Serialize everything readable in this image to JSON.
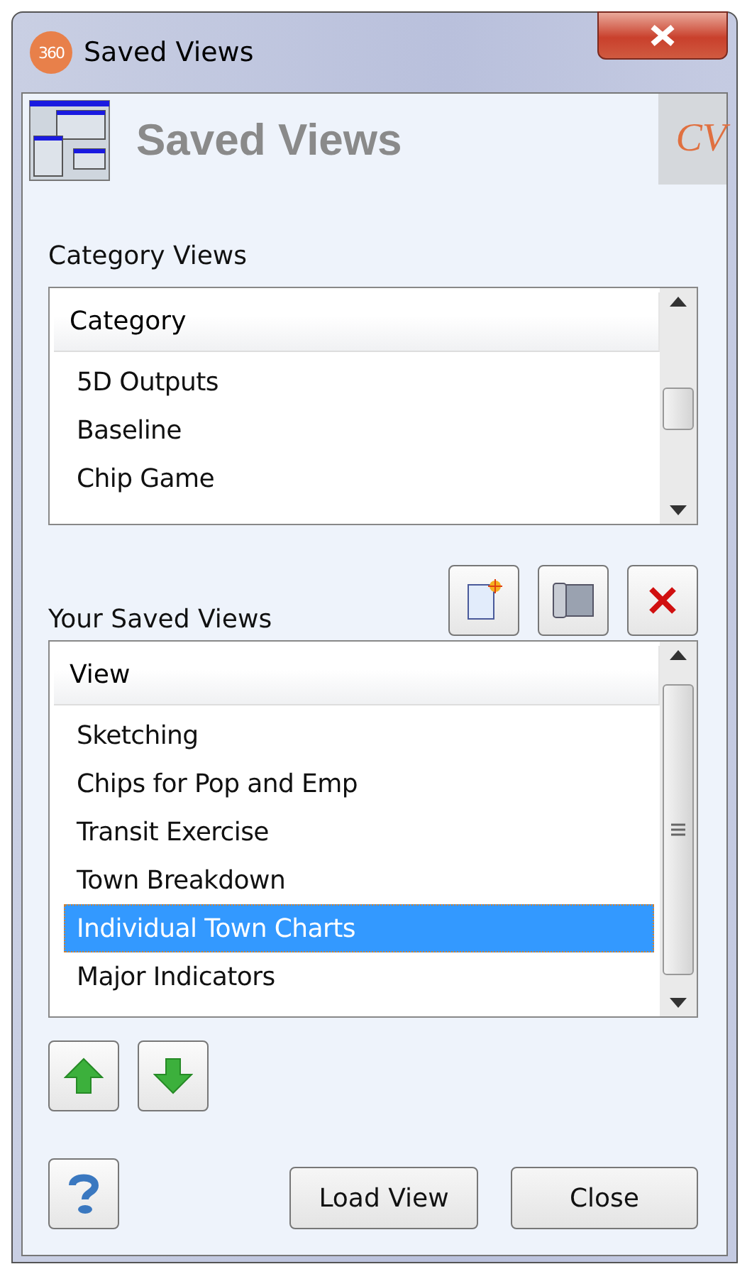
{
  "window": {
    "app_badge": "360",
    "title": "Saved Views"
  },
  "header": {
    "title": "Saved Views",
    "logo": "CV"
  },
  "category_views": {
    "label": "Category Views",
    "column": "Category",
    "items": [
      {
        "label": "5D Outputs",
        "selected": false
      },
      {
        "label": "Baseline",
        "selected": false
      },
      {
        "label": "Chip Game",
        "selected": false
      }
    ]
  },
  "saved_views": {
    "label": "Your Saved Views",
    "column": "View",
    "items": [
      {
        "label": "Sketching",
        "selected": false
      },
      {
        "label": "Chips for Pop and Emp",
        "selected": false
      },
      {
        "label": "Transit Exercise",
        "selected": false
      },
      {
        "label": "Town Breakdown",
        "selected": false
      },
      {
        "label": "Individual Town Charts",
        "selected": true
      },
      {
        "label": "Major Indicators",
        "selected": false
      }
    ]
  },
  "buttons": [
    "Load View",
    "Close"
  ]
}
